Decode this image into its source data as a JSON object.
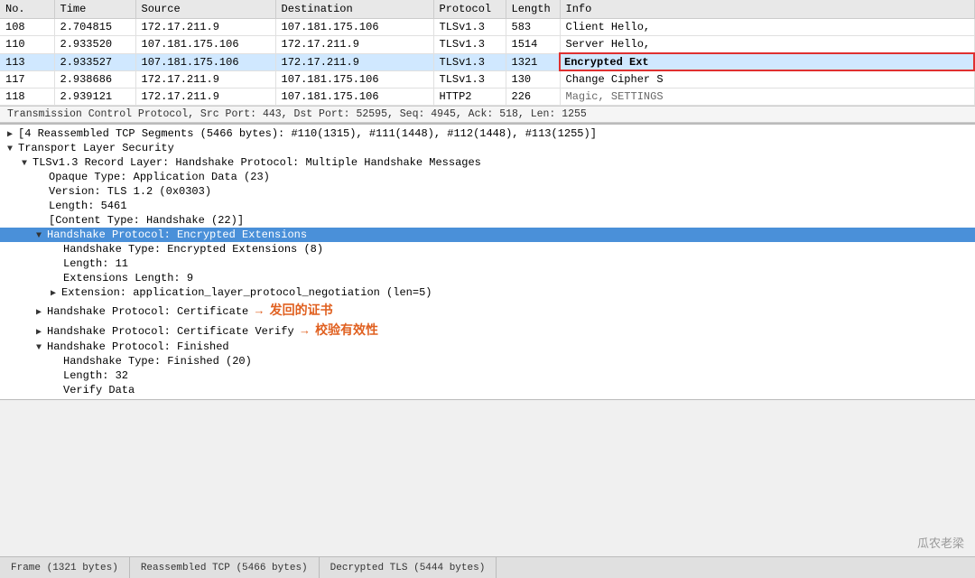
{
  "table": {
    "columns": [
      "No.",
      "Time",
      "Source",
      "Destination",
      "Protocol",
      "Length",
      "Info"
    ],
    "rows": [
      {
        "no": "108",
        "time": "2.704815",
        "source": "172.17.211.9",
        "destination": "107.181.175.106",
        "protocol": "TLSv1.3",
        "length": "583",
        "info": "Client Hello,",
        "selected": false,
        "highlighted": false
      },
      {
        "no": "110",
        "time": "2.933520",
        "source": "107.181.175.106",
        "destination": "172.17.211.9",
        "protocol": "TLSv1.3",
        "length": "1514",
        "info": "Server Hello,",
        "selected": false,
        "highlighted": false
      },
      {
        "no": "113",
        "time": "2.933527",
        "source": "107.181.175.106",
        "destination": "172.17.211.9",
        "protocol": "TLSv1.3",
        "length": "1321",
        "info": "Encrypted Ext",
        "selected": true,
        "highlighted": true,
        "info_outlined": true
      },
      {
        "no": "117",
        "time": "2.938686",
        "source": "172.17.211.9",
        "destination": "107.181.175.106",
        "protocol": "TLSv1.3",
        "length": "130",
        "info": "Change Cipher S",
        "selected": false,
        "highlighted": false
      },
      {
        "no": "118",
        "time": "2.939121",
        "source": "172.17.211.9",
        "destination": "107.181.175.106",
        "protocol": "HTTP2",
        "length": "226",
        "info": "Magic, SETTINGS",
        "selected": false,
        "highlighted": false,
        "partial": true
      }
    ]
  },
  "tcp_bar": {
    "text": "Transmission Control Protocol, Src Port: 443, Dst Port: 52595, Seq: 4945, Ack: 518, Len: 1255"
  },
  "detail_rows": [
    {
      "indent": 0,
      "expand": "▶",
      "text": "[4 Reassembled TCP Segments (5466 bytes): #110(1315), #111(1448), #112(1448), #113(1255)]",
      "selected": false
    },
    {
      "indent": 0,
      "expand": "▼",
      "text": "Transport Layer Security",
      "selected": false
    },
    {
      "indent": 1,
      "expand": "▼",
      "text": "TLSv1.3 Record Layer: Handshake Protocol: Multiple Handshake Messages",
      "selected": false
    },
    {
      "indent": 2,
      "expand": "",
      "text": "Opaque Type: Application Data (23)",
      "selected": false
    },
    {
      "indent": 2,
      "expand": "",
      "text": "Version: TLS 1.2 (0x0303)",
      "selected": false
    },
    {
      "indent": 2,
      "expand": "",
      "text": "Length: 5461",
      "selected": false
    },
    {
      "indent": 2,
      "expand": "",
      "text": "[Content Type: Handshake (22)]",
      "selected": false
    },
    {
      "indent": 2,
      "expand": "▼",
      "text": "Handshake Protocol: Encrypted Extensions",
      "selected": true,
      "annotation": null
    },
    {
      "indent": 3,
      "expand": "",
      "text": "Handshake Type: Encrypted Extensions (8)",
      "selected": false
    },
    {
      "indent": 3,
      "expand": "",
      "text": "Length: 11",
      "selected": false
    },
    {
      "indent": 3,
      "expand": "",
      "text": "Extensions Length: 9",
      "selected": false
    },
    {
      "indent": 3,
      "expand": "▶",
      "text": "Extension: application_layer_protocol_negotiation (len=5)",
      "selected": false
    },
    {
      "indent": 2,
      "expand": "▶",
      "text": "Handshake Protocol: Certificate",
      "selected": false,
      "annotation": "发回的证书",
      "annotation_type": "certificate"
    },
    {
      "indent": 2,
      "expand": "▶",
      "text": "Handshake Protocol: Certificate Verify",
      "selected": false,
      "annotation": "校验有效性",
      "annotation_type": "verify"
    },
    {
      "indent": 2,
      "expand": "▼",
      "text": "Handshake Protocol: Finished",
      "selected": false
    },
    {
      "indent": 3,
      "expand": "",
      "text": "Handshake Type: Finished (20)",
      "selected": false
    },
    {
      "indent": 3,
      "expand": "",
      "text": "Length: 32",
      "selected": false
    },
    {
      "indent": 3,
      "expand": "",
      "text": "Verify Data",
      "selected": false
    }
  ],
  "status_bar": {
    "items": [
      "Frame (1321 bytes)",
      "Reassembled TCP (5466 bytes)",
      "Decrypted TLS (5444 bytes)"
    ]
  },
  "watermark": "瓜农老梁"
}
